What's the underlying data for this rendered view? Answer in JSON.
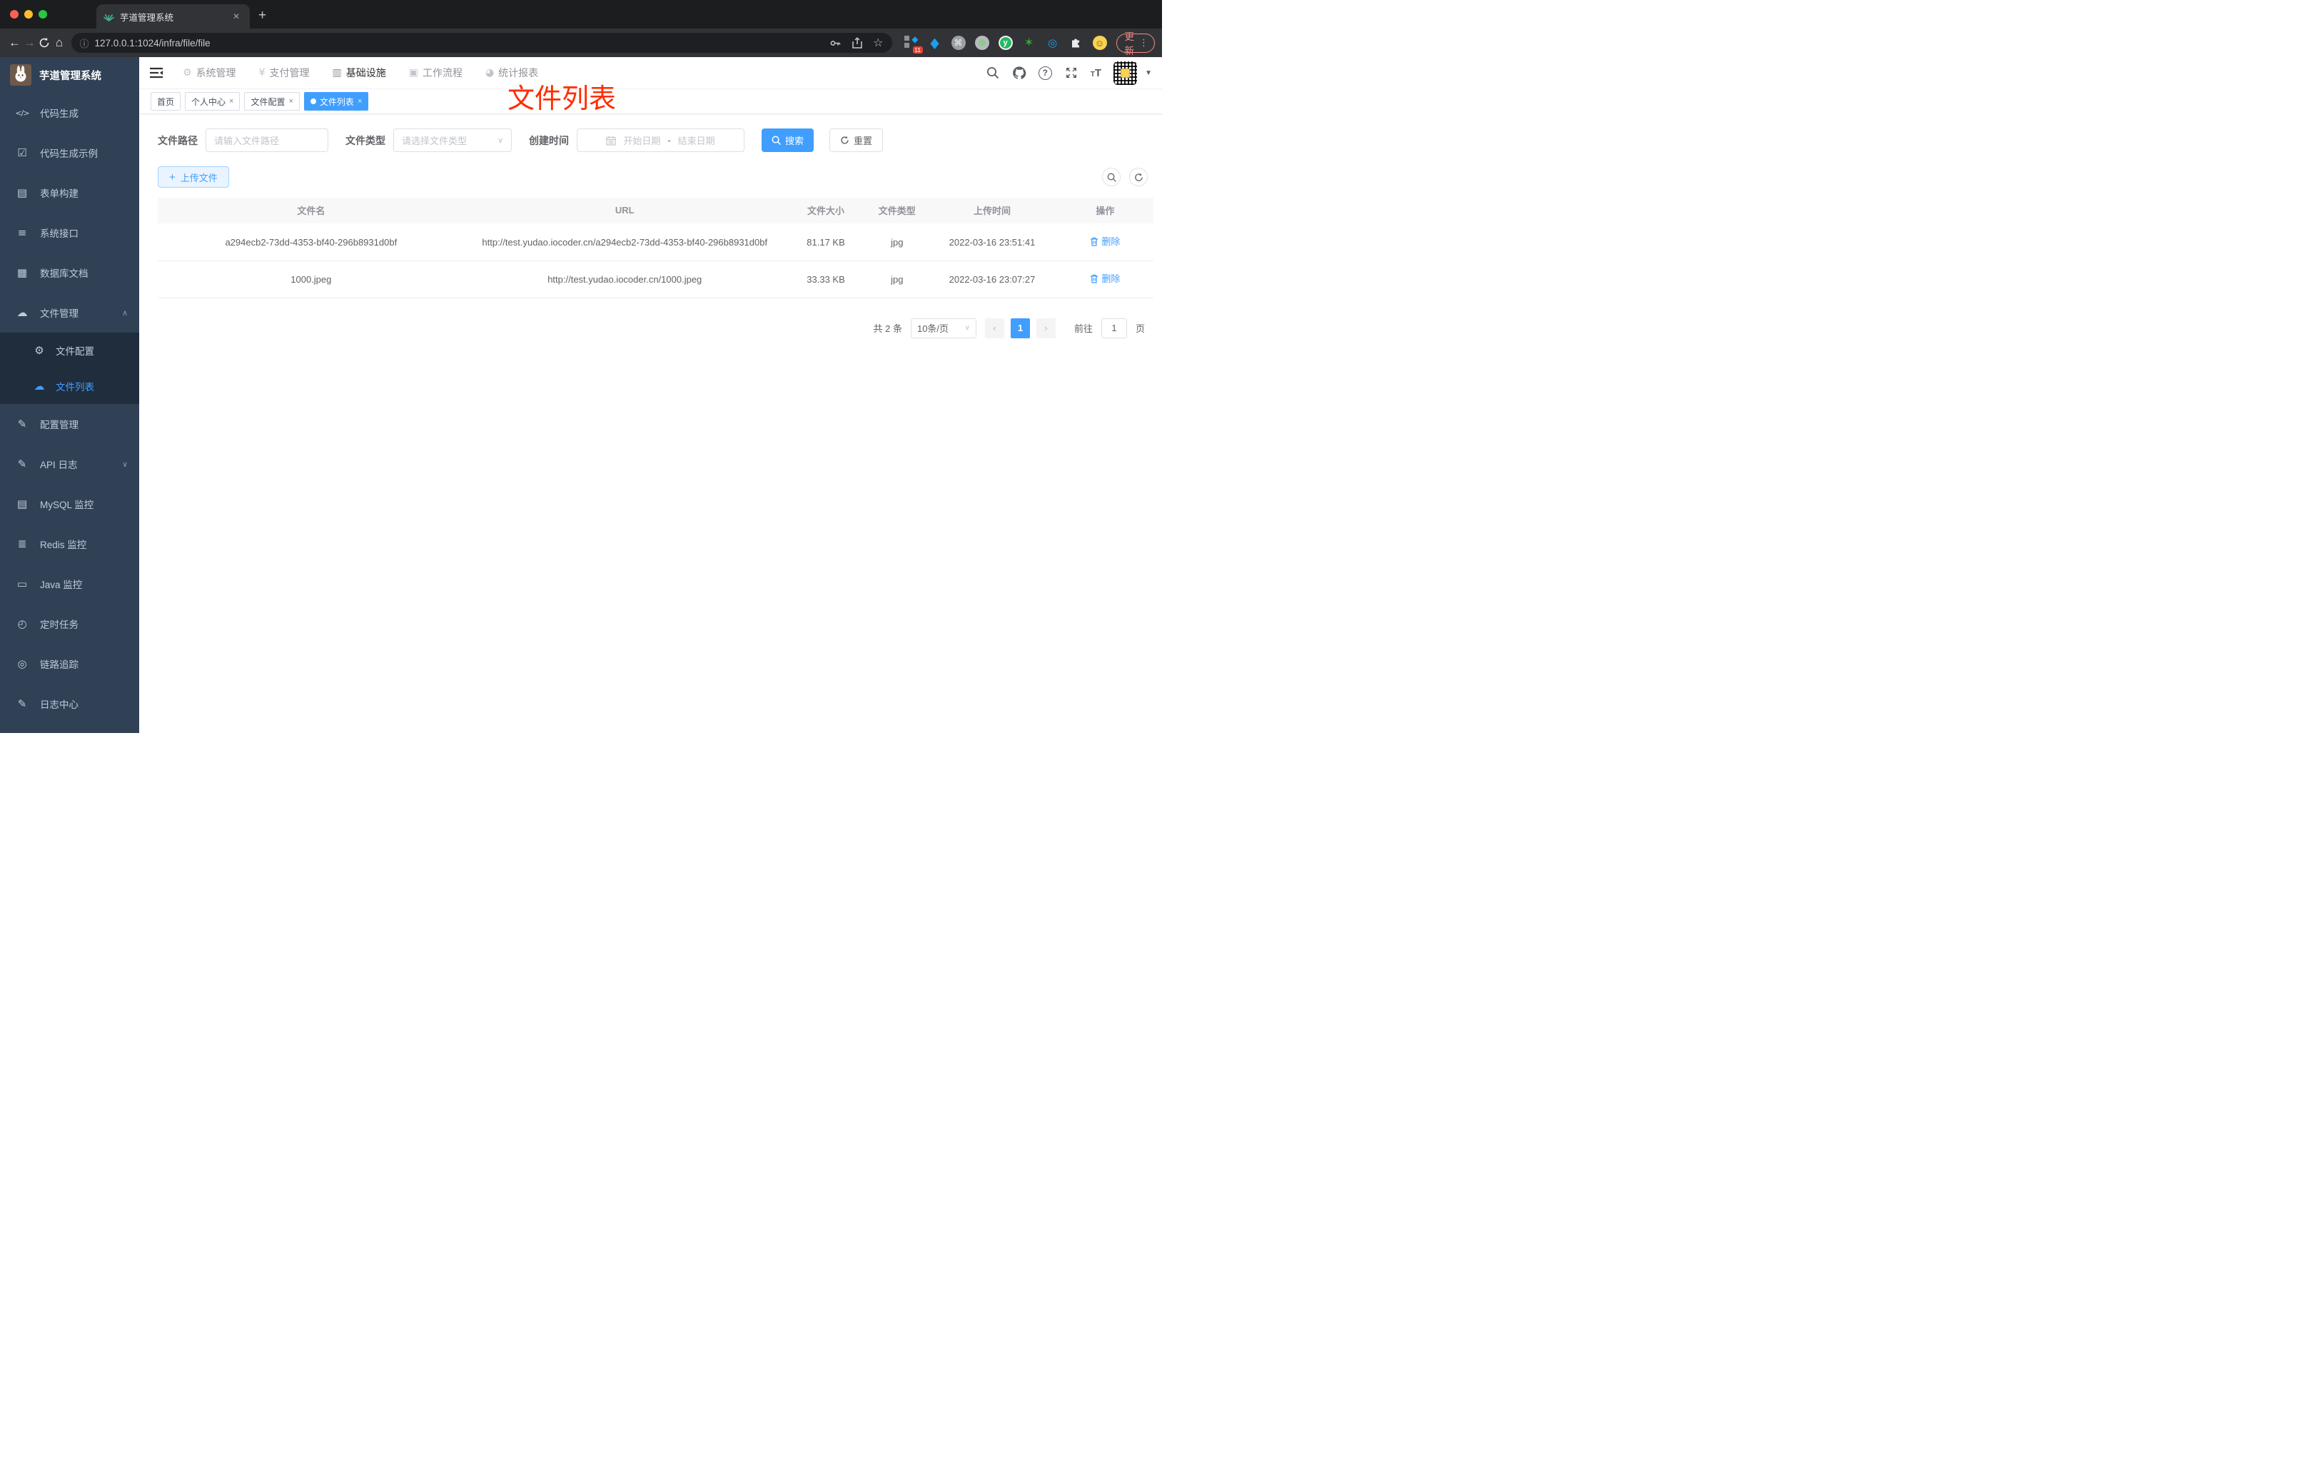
{
  "browser": {
    "tab_title": "芋道管理系统",
    "url": "127.0.0.1:1024/infra/file/file",
    "new_tab_label": "+",
    "tab_close_label": "✕",
    "extensions_badge": "11",
    "update_label": "更新"
  },
  "sidebar": {
    "title": "芋道管理系统",
    "items": [
      {
        "name": "code-generation",
        "icon": "code-icon",
        "glyph": "</>",
        "label": "代码生成"
      },
      {
        "name": "code-gen-example",
        "icon": "shield-check-icon",
        "glyph": "☑",
        "label": "代码生成示例"
      },
      {
        "name": "form-builder",
        "icon": "form-grid-icon",
        "glyph": "▤",
        "label": "表单构建"
      },
      {
        "name": "system-api",
        "icon": "sliders-icon",
        "glyph": "≡",
        "label": "系统接口"
      },
      {
        "name": "database-doc",
        "icon": "table-grid-icon",
        "glyph": "▦",
        "label": "数据库文档"
      },
      {
        "name": "file-management",
        "icon": "cloud-download-icon",
        "glyph": "☁",
        "label": "文件管理",
        "caret": "∧",
        "children": [
          {
            "name": "file-config",
            "icon": "gear-icon",
            "glyph": "⚙",
            "label": "文件配置",
            "active": false
          },
          {
            "name": "file-list",
            "icon": "cloud-upload-icon",
            "glyph": "☁",
            "label": "文件列表",
            "active": true
          }
        ]
      },
      {
        "name": "config-management",
        "icon": "edit-icon",
        "glyph": "✎",
        "label": "配置管理"
      },
      {
        "name": "api-log",
        "icon": "document-edit-icon",
        "glyph": "✎",
        "label": "API 日志",
        "caret": "∨"
      },
      {
        "name": "mysql-monitor",
        "icon": "chart-monitor-icon",
        "glyph": "▤",
        "label": "MySQL 监控"
      },
      {
        "name": "redis-monitor",
        "icon": "layers-icon",
        "glyph": "≣",
        "label": "Redis 监控"
      },
      {
        "name": "java-monitor",
        "icon": "monitor-icon",
        "glyph": "▭",
        "label": "Java 监控"
      },
      {
        "name": "scheduled-tasks",
        "icon": "clock-icon",
        "glyph": "◴",
        "label": "定时任务"
      },
      {
        "name": "trace-tracking",
        "icon": "eye-icon",
        "glyph": "◎",
        "label": "链路追踪"
      },
      {
        "name": "log-center",
        "icon": "document-edit-icon",
        "glyph": "✎",
        "label": "日志中心"
      }
    ]
  },
  "header": {
    "menus": [
      {
        "name": "system-management",
        "icon": "gear-icon",
        "glyph": "⚙",
        "label": "系统管理",
        "active": false
      },
      {
        "name": "payment-management",
        "icon": "yen-icon",
        "glyph": "¥",
        "label": "支付管理",
        "active": false
      },
      {
        "name": "infrastructure",
        "icon": "monitor-check-icon",
        "glyph": "▥",
        "label": "基础设施",
        "active": true
      },
      {
        "name": "workflow",
        "icon": "briefcase-icon",
        "glyph": "▣",
        "label": "工作流程",
        "active": false
      },
      {
        "name": "statistics-report",
        "icon": "pie-chart-icon",
        "glyph": "◕",
        "label": "统计报表",
        "active": false
      }
    ]
  },
  "tags": [
    {
      "name": "home",
      "label": "首页",
      "closable": false,
      "active": false
    },
    {
      "name": "profile",
      "label": "个人中心",
      "closable": true,
      "active": false
    },
    {
      "name": "file-config",
      "label": "文件配置",
      "closable": true,
      "active": false
    },
    {
      "name": "file-list",
      "label": "文件列表",
      "closable": true,
      "active": true
    }
  ],
  "annotation": {
    "text": "文件列表",
    "color": "#ff2d00"
  },
  "filters": {
    "path_label": "文件路径",
    "path_placeholder": "请输入文件路径",
    "type_label": "文件类型",
    "type_placeholder": "请选择文件类型",
    "date_label": "创建时间",
    "date_start_placeholder": "开始日期",
    "date_separator": "-",
    "date_end_placeholder": "结束日期",
    "search_label": "搜索",
    "reset_label": "重置"
  },
  "toolbar": {
    "upload_label": "上传文件"
  },
  "table": {
    "columns": [
      "文件名",
      "URL",
      "文件大小",
      "文件类型",
      "上传时间",
      "操作"
    ],
    "col_widths": [
      "30.8%",
      "32.2%",
      "8.2%",
      "6.1%",
      "13%",
      "9.7%"
    ],
    "rows": [
      {
        "name": "a294ecb2-73dd-4353-bf40-296b8931d0bf",
        "url": "http://test.yudao.iocoder.cn/a294ecb2-73dd-4353-bf40-296b8931d0bf",
        "size": "81.17 KB",
        "type": "jpg",
        "time": "2022-03-16 23:51:41",
        "action": "删除"
      },
      {
        "name": "1000.jpeg",
        "url": "http://test.yudao.iocoder.cn/1000.jpeg",
        "size": "33.33 KB",
        "type": "jpg",
        "time": "2022-03-16 23:07:27",
        "action": "删除"
      }
    ]
  },
  "pagination": {
    "total": "共 2 条",
    "page_size": "10条/页",
    "prev": "‹",
    "next": "›",
    "current_page": "1",
    "goto_label": "前往",
    "goto_value": "1",
    "goto_unit": "页"
  },
  "colors": {
    "accent": "#409eff",
    "sidebar_bg": "#304156",
    "submenu_bg": "#1f2d3d",
    "annotation_red": "#ff2d00",
    "favicon_teal": "#3eb08f"
  }
}
